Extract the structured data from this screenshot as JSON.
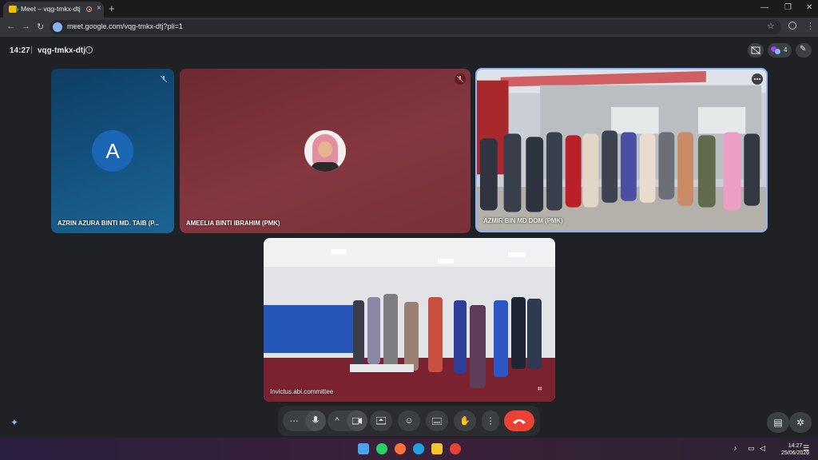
{
  "browser": {
    "tab_title": "Meet – vqg-tmkx-dtj",
    "url": "meet.google.com/vqg-tmkx-dtj?pli=1",
    "new_tab": "+",
    "tab_close": "×"
  },
  "meeting": {
    "time": "14:27",
    "separator": "|",
    "code": "vqg-tmkx-dtj",
    "people_count": "4"
  },
  "participants": [
    {
      "name": "AZRIN AZURA BINTI MD. TAIB (P...",
      "initial": "A",
      "muted": true
    },
    {
      "name": "AMEELIA BINTI IBRAHIM (PMK)",
      "muted": true
    },
    {
      "name": "AZMIR BIN MD DOM (PMK)",
      "muted": false
    },
    {
      "name": "Invictus.abi.committee",
      "muted": false
    }
  ],
  "colors": {
    "tile1_bg": "#12466f",
    "tile2_bg": "#7a2f36",
    "end_call": "#ea4335",
    "active_border": "#8ab4f8"
  },
  "taskbar": {
    "time": "14:27",
    "date": "25/06/2026"
  }
}
